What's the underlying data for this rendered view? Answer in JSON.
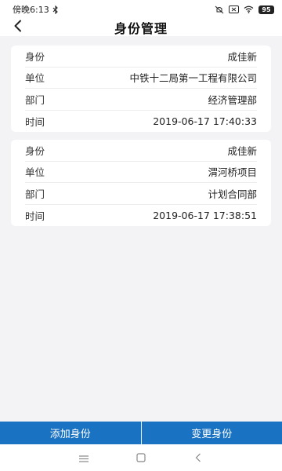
{
  "status_bar": {
    "time": "傍晚6:13",
    "battery": "95",
    "icons": [
      "bluetooth-icon",
      "mute-icon",
      "sim-icon",
      "wifi-icon",
      "battery-icon"
    ]
  },
  "header": {
    "title": "身份管理",
    "back_icon": "chevron-left-icon"
  },
  "identities": [
    {
      "rows": [
        {
          "label": "身份",
          "value": "成佳新"
        },
        {
          "label": "单位",
          "value": "中铁十二局第一工程有限公司"
        },
        {
          "label": "部门",
          "value": "经济管理部"
        },
        {
          "label": "时间",
          "value": "2019-06-17 17:40:33"
        }
      ]
    },
    {
      "rows": [
        {
          "label": "身份",
          "value": "成佳新"
        },
        {
          "label": "单位",
          "value": "渭河桥项目"
        },
        {
          "label": "部门",
          "value": "计划合同部"
        },
        {
          "label": "时间",
          "value": "2019-06-17 17:38:51"
        }
      ]
    }
  ],
  "actions": {
    "add_label": "添加身份",
    "change_label": "变更身份"
  },
  "colors": {
    "accent": "#1a72c2",
    "background": "#f3f3f5",
    "card": "#ffffff"
  },
  "system_nav": [
    "menu-icon",
    "home-icon",
    "back-icon"
  ]
}
